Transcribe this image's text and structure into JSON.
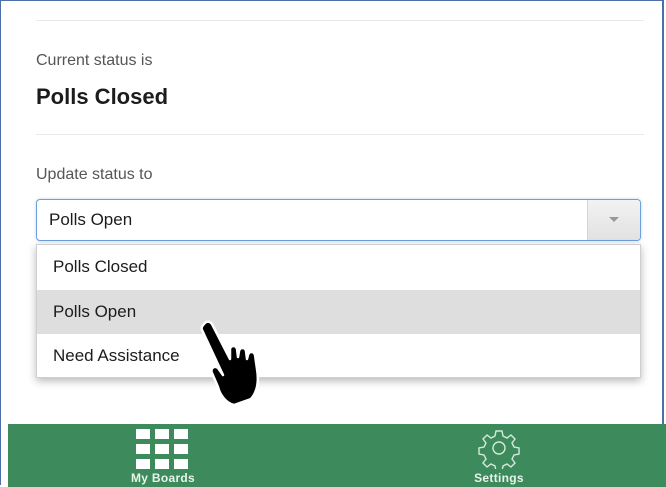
{
  "status": {
    "current_label": "Current status is",
    "current_value": "Polls Closed"
  },
  "update": {
    "label": "Update status to",
    "selected_value": "Polls Open",
    "options": [
      "Polls Closed",
      "Polls Open",
      "Need Assistance"
    ],
    "highlighted_index": 1
  },
  "nav": {
    "items": [
      {
        "label": "My Boards",
        "icon": "grid-icon"
      },
      {
        "label": "Settings",
        "icon": "gear-icon"
      }
    ]
  },
  "colors": {
    "nav_background": "#3d8b5c",
    "select_border": "#6c9fdc",
    "highlight_row": "#dedede"
  }
}
